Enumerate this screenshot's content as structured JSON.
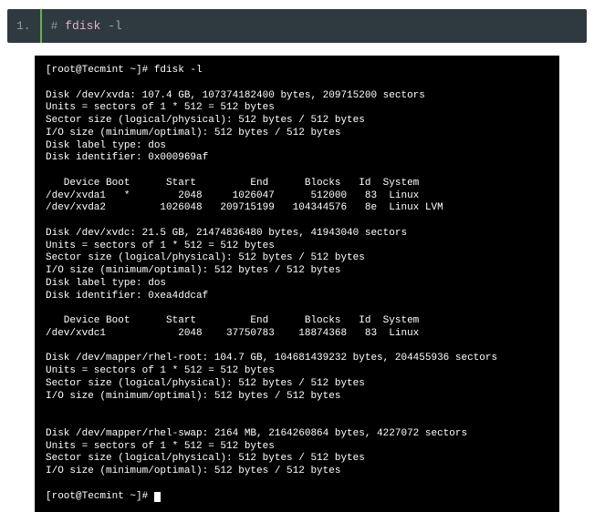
{
  "codeblock": {
    "line_number": "1.",
    "hash": "#",
    "command": "fdisk",
    "flag": "-l"
  },
  "terminal": {
    "prompt1": "[root@Tecmint ~]# fdisk -l",
    "blank": "",
    "xvda_header": "Disk /dev/xvda: 107.4 GB, 107374182400 bytes, 209715200 sectors",
    "xvda_units": "Units = sectors of 1 * 512 = 512 bytes",
    "xvda_sector": "Sector size (logical/physical): 512 bytes / 512 bytes",
    "xvda_io": "I/O size (minimum/optimal): 512 bytes / 512 bytes",
    "xvda_label": "Disk label type: dos",
    "xvda_ident": "Disk identifier: 0x000969af",
    "part_hdr1": "   Device Boot      Start         End      Blocks   Id  System",
    "xvda1": "/dev/xvda1   *        2048     1026047      512000   83  Linux",
    "xvda2": "/dev/xvda2         1026048   209715199   104344576   8e  Linux LVM",
    "xvdc_header": "Disk /dev/xvdc: 21.5 GB, 21474836480 bytes, 41943040 sectors",
    "xvdc_units": "Units = sectors of 1 * 512 = 512 bytes",
    "xvdc_sector": "Sector size (logical/physical): 512 bytes / 512 bytes",
    "xvdc_io": "I/O size (minimum/optimal): 512 bytes / 512 bytes",
    "xvdc_label": "Disk label type: dos",
    "xvdc_ident": "Disk identifier: 0xea4ddcaf",
    "part_hdr2": "   Device Boot      Start         End      Blocks   Id  System",
    "xvdc1": "/dev/xvdc1            2048    37750783    18874368   83  Linux",
    "rhel_root_header": "Disk /dev/mapper/rhel-root: 104.7 GB, 104681439232 bytes, 204455936 sectors",
    "rhel_root_units": "Units = sectors of 1 * 512 = 512 bytes",
    "rhel_root_sector": "Sector size (logical/physical): 512 bytes / 512 bytes",
    "rhel_root_io": "I/O size (minimum/optimal): 512 bytes / 512 bytes",
    "rhel_swap_header": "Disk /dev/mapper/rhel-swap: 2164 MB, 2164260864 bytes, 4227072 sectors",
    "rhel_swap_units": "Units = sectors of 1 * 512 = 512 bytes",
    "rhel_swap_sector": "Sector size (logical/physical): 512 bytes / 512 bytes",
    "rhel_swap_io": "I/O size (minimum/optimal): 512 bytes / 512 bytes",
    "prompt2": "[root@Tecmint ~]# "
  }
}
